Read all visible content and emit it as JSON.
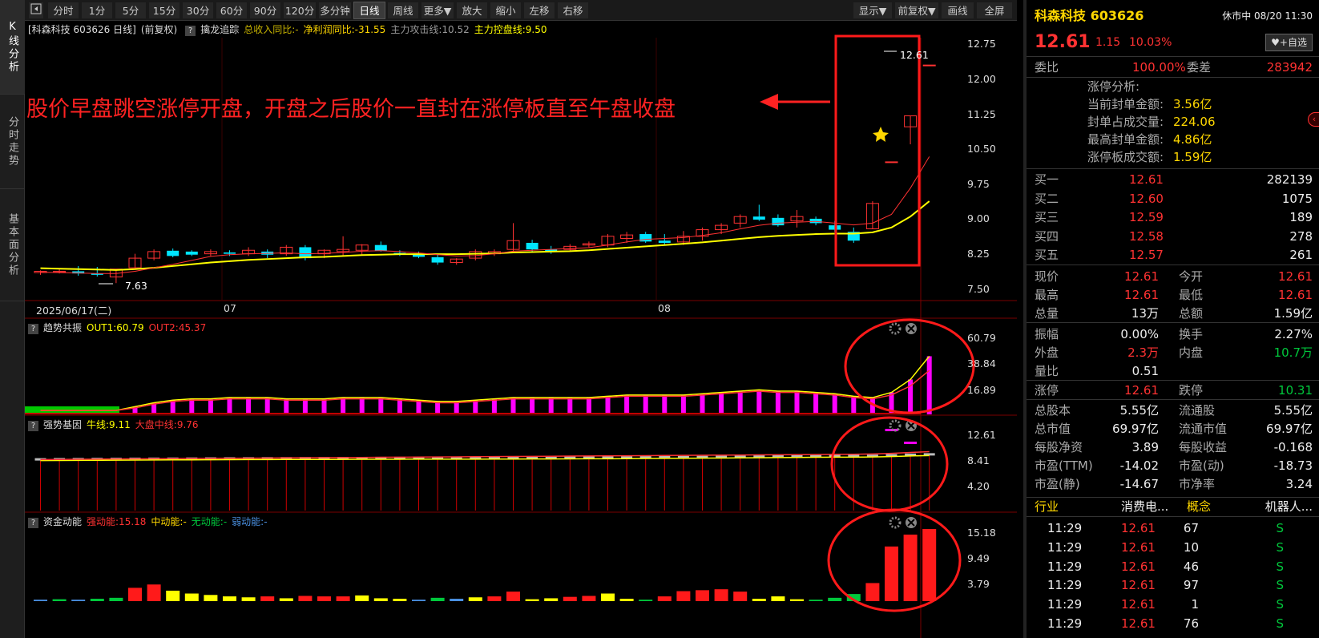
{
  "left_tabs": [
    "K线分析",
    "分时走势",
    "基本面分析"
  ],
  "toolbar": {
    "collapse_icon": "left-bracket-arrow-icon",
    "periods": [
      "分时",
      "1分",
      "5分",
      "15分",
      "30分",
      "60分",
      "90分",
      "120分",
      "多分钟",
      "日线",
      "周线",
      "更多▼"
    ],
    "active_period": "日线",
    "actions": [
      "放大",
      "缩小",
      "左移",
      "右移"
    ],
    "right_actions": [
      "显示▼",
      "前复权▼",
      "画线",
      "全屏"
    ]
  },
  "colors": {
    "up": "#ff3232",
    "down": "#00e5ff",
    "ma_yellow": "#ffff00",
    "magenta": "#ff00ff",
    "green": "#00c83c",
    "annotation": "#ff2222"
  },
  "main_chart": {
    "header": {
      "title": "[科森科技 603626 日线]",
      "adjust": "(前复权)",
      "q": "?",
      "indicator": "擒龙追踪",
      "revenue": "总收入同比:-",
      "profit": "净利润同比:-31.55",
      "attack": "主力攻击线:10.52",
      "control": "主力控盘线:9.50"
    },
    "annotation": "股价早盘跳空涨停开盘，开盘之后股价一直封在涨停板直至午盘收盘",
    "high_label": "12.61",
    "low_label": "7.63",
    "date_labels": [
      "2025/06/17(二)",
      "07",
      "08"
    ],
    "y_ticks": [
      "12.75",
      "12.00",
      "11.25",
      "10.50",
      "9.75",
      "9.00",
      "8.25",
      "7.50"
    ]
  },
  "panel1": {
    "q": "?",
    "name": "趋势共振",
    "out1": "OUT1:60.79",
    "out2": "OUT2:45.37",
    "y_ticks": [
      "60.79",
      "38.84",
      "16.89"
    ]
  },
  "panel2": {
    "q": "?",
    "name": "强势基因",
    "bull": "牛线:9.11",
    "market": "大盘中线:9.76",
    "y_ticks": [
      "12.61",
      "8.41",
      "4.20"
    ]
  },
  "panel3": {
    "q": "?",
    "name": "资金动能",
    "strong": "强动能:15.18",
    "mid": "中动能:-",
    "none": "无动能:-",
    "weak": "弱动能:-",
    "y_ticks": [
      "15.18",
      "9.49",
      "3.79"
    ]
  },
  "chart_data": {
    "type": "candlestick",
    "candles": [
      [
        7.87,
        7.92,
        7.82,
        7.9
      ],
      [
        7.88,
        7.95,
        7.85,
        7.9
      ],
      [
        7.9,
        8.02,
        7.8,
        7.85
      ],
      [
        7.85,
        8.0,
        7.78,
        7.82
      ],
      [
        7.77,
        7.95,
        7.63,
        7.95
      ],
      [
        7.98,
        8.3,
        7.95,
        8.2
      ],
      [
        8.2,
        8.4,
        8.15,
        8.35
      ],
      [
        8.37,
        8.42,
        8.22,
        8.25
      ],
      [
        8.35,
        8.38,
        8.25,
        8.28
      ],
      [
        8.3,
        8.4,
        8.25,
        8.35
      ],
      [
        8.33,
        8.38,
        8.25,
        8.3
      ],
      [
        8.3,
        8.45,
        8.25,
        8.38
      ],
      [
        8.35,
        8.4,
        8.2,
        8.28
      ],
      [
        8.3,
        8.5,
        8.25,
        8.45
      ],
      [
        8.45,
        8.5,
        8.15,
        8.2
      ],
      [
        8.3,
        8.4,
        8.2,
        8.38
      ],
      [
        8.35,
        8.7,
        8.25,
        8.4
      ],
      [
        8.38,
        8.52,
        8.28,
        8.5
      ],
      [
        8.5,
        8.58,
        8.35,
        8.37
      ],
      [
        8.32,
        8.38,
        8.25,
        8.28
      ],
      [
        8.3,
        8.35,
        8.2,
        8.23
      ],
      [
        8.22,
        8.3,
        8.05,
        8.1
      ],
      [
        8.1,
        8.2,
        8.05,
        8.18
      ],
      [
        8.2,
        8.4,
        8.15,
        8.35
      ],
      [
        8.3,
        8.4,
        8.25,
        8.35
      ],
      [
        8.4,
        9.0,
        8.35,
        8.6
      ],
      [
        8.55,
        8.62,
        8.35,
        8.4
      ],
      [
        8.4,
        8.48,
        8.3,
        8.35
      ],
      [
        8.4,
        8.52,
        8.35,
        8.47
      ],
      [
        8.5,
        8.58,
        8.45,
        8.53
      ],
      [
        8.5,
        8.75,
        8.45,
        8.7
      ],
      [
        8.65,
        8.8,
        8.55,
        8.73
      ],
      [
        8.75,
        8.8,
        8.55,
        8.58
      ],
      [
        8.6,
        8.75,
        8.5,
        8.55
      ],
      [
        8.57,
        8.82,
        8.5,
        8.7
      ],
      [
        8.7,
        8.9,
        8.6,
        8.85
      ],
      [
        8.85,
        9.0,
        8.75,
        8.95
      ],
      [
        9.0,
        9.2,
        8.9,
        9.15
      ],
      [
        9.15,
        9.42,
        9.05,
        9.08
      ],
      [
        9.12,
        9.2,
        8.92,
        8.95
      ],
      [
        9.05,
        9.3,
        8.9,
        9.15
      ],
      [
        9.1,
        9.15,
        8.95,
        9.0
      ],
      [
        8.95,
        9.05,
        8.8,
        8.85
      ],
      [
        8.8,
        8.9,
        8.55,
        8.6
      ],
      [
        8.87,
        9.5,
        8.87,
        9.45
      ],
      [
        10.4,
        10.4,
        10.4,
        10.4
      ],
      [
        11.2,
        11.45,
        10.8,
        11.45
      ],
      [
        12.61,
        12.61,
        12.61,
        12.61
      ]
    ],
    "ma_yellow": [
      7.97,
      7.96,
      7.95,
      7.94,
      7.93,
      7.95,
      7.98,
      8.02,
      8.06,
      8.1,
      8.13,
      8.16,
      8.18,
      8.2,
      8.22,
      8.23,
      8.25,
      8.27,
      8.28,
      8.29,
      8.29,
      8.29,
      8.29,
      8.3,
      8.31,
      8.33,
      8.34,
      8.35,
      8.36,
      8.38,
      8.41,
      8.44,
      8.47,
      8.5,
      8.53,
      8.56,
      8.6,
      8.64,
      8.68,
      8.71,
      8.73,
      8.75,
      8.76,
      8.76,
      8.79,
      8.9,
      9.15,
      9.5
    ],
    "ma_red": [
      7.88,
      7.87,
      7.86,
      7.85,
      7.85,
      7.9,
      7.98,
      8.06,
      8.15,
      8.24,
      8.28,
      8.3,
      8.31,
      8.32,
      8.3,
      8.31,
      8.33,
      8.36,
      8.37,
      8.35,
      8.32,
      8.28,
      8.25,
      8.26,
      8.3,
      8.36,
      8.38,
      8.4,
      8.42,
      8.44,
      8.5,
      8.57,
      8.63,
      8.65,
      8.67,
      8.72,
      8.78,
      8.87,
      8.95,
      9.0,
      9.02,
      9.04,
      9.0,
      8.96,
      9.0,
      9.2,
      9.8,
      10.52
    ],
    "trend_out1": [
      3,
      3,
      3,
      3,
      3,
      6,
      9,
      11,
      12,
      12,
      13,
      13,
      13,
      12,
      12,
      12,
      13,
      13,
      13,
      12,
      11,
      10,
      10,
      11,
      12,
      13,
      13,
      13,
      13,
      13,
      14,
      15,
      15,
      15,
      15,
      16,
      17,
      18,
      19,
      18,
      18,
      17,
      16,
      14,
      13,
      17,
      27,
      45,
      60.79
    ],
    "trend_out2": [
      3,
      3,
      3,
      3,
      3,
      5,
      8,
      10,
      11,
      11,
      12,
      12,
      12,
      11,
      11,
      11,
      12,
      12,
      12,
      11,
      10,
      9,
      9,
      10,
      11,
      12,
      12,
      12,
      12,
      12,
      13,
      14,
      14,
      14,
      14,
      15,
      16,
      17,
      18,
      17,
      17,
      16,
      15,
      13,
      12,
      15,
      22,
      34,
      45.37
    ],
    "gene_bull": [
      8.28,
      8.3,
      8.31,
      8.33,
      8.35,
      8.37,
      8.38,
      8.39,
      8.4,
      8.42,
      8.43,
      8.44,
      8.45,
      8.46,
      8.47,
      8.47,
      8.48,
      8.49,
      8.5,
      8.5,
      8.51,
      8.51,
      8.52,
      8.52,
      8.53,
      8.53,
      8.54,
      8.55,
      8.56,
      8.57,
      8.58,
      8.6,
      8.62,
      8.64,
      8.66,
      8.68,
      8.7,
      8.72,
      8.75,
      8.78,
      8.8,
      8.82,
      8.84,
      8.85,
      8.87,
      8.95,
      9.05,
      9.11
    ],
    "gene_market": [
      8.45,
      8.47,
      8.5,
      8.52,
      8.54,
      8.56,
      8.58,
      8.6,
      8.62,
      8.64,
      8.66,
      8.68,
      8.7,
      8.72,
      8.74,
      8.76,
      8.78,
      8.8,
      8.82,
      8.84,
      8.86,
      8.88,
      8.9,
      8.92,
      8.94,
      8.96,
      8.98,
      9.0,
      9.02,
      9.04,
      9.06,
      9.08,
      9.1,
      9.12,
      9.14,
      9.16,
      9.18,
      9.2,
      9.22,
      9.24,
      9.26,
      9.28,
      9.3,
      9.33,
      9.38,
      9.48,
      9.62,
      9.76
    ],
    "fund_bars": [
      [
        0.3,
        "blue"
      ],
      [
        0.4,
        "green"
      ],
      [
        0.3,
        "blue"
      ],
      [
        0.5,
        "green"
      ],
      [
        0.7,
        "green"
      ],
      [
        2.8,
        "red"
      ],
      [
        3.5,
        "red"
      ],
      [
        2.2,
        "yellow"
      ],
      [
        1.6,
        "yellow"
      ],
      [
        1.3,
        "yellow"
      ],
      [
        1.0,
        "yellow"
      ],
      [
        0.8,
        "yellow"
      ],
      [
        1.0,
        "red"
      ],
      [
        0.6,
        "yellow"
      ],
      [
        1.1,
        "red"
      ],
      [
        1.0,
        "red"
      ],
      [
        1.0,
        "red"
      ],
      [
        1.2,
        "yellow"
      ],
      [
        0.6,
        "yellow"
      ],
      [
        0.5,
        "yellow"
      ],
      [
        0.3,
        "blue"
      ],
      [
        0.7,
        "green"
      ],
      [
        0.5,
        "blue"
      ],
      [
        0.8,
        "yellow"
      ],
      [
        1.0,
        "red"
      ],
      [
        2.0,
        "red"
      ],
      [
        0.4,
        "yellow"
      ],
      [
        0.6,
        "yellow"
      ],
      [
        0.9,
        "red"
      ],
      [
        1.1,
        "red"
      ],
      [
        1.6,
        "yellow"
      ],
      [
        0.5,
        "yellow"
      ],
      [
        0.3,
        "green"
      ],
      [
        1.0,
        "red"
      ],
      [
        2.1,
        "red"
      ],
      [
        2.3,
        "red"
      ],
      [
        2.5,
        "red"
      ],
      [
        2.0,
        "red"
      ],
      [
        0.5,
        "yellow"
      ],
      [
        1.0,
        "yellow"
      ],
      [
        0.4,
        "yellow"
      ],
      [
        0.3,
        "green"
      ],
      [
        0.7,
        "green"
      ],
      [
        1.5,
        "green"
      ],
      [
        3.8,
        "red"
      ],
      [
        11.5,
        "red"
      ],
      [
        14.0,
        "red"
      ],
      [
        15.18,
        "red"
      ]
    ]
  },
  "right_panel": {
    "name": "科森科技 603626",
    "status": "休市中 08/20 11:30",
    "price": "12.61",
    "change": "1.15",
    "change_pct": "10.03%",
    "watch_btn": "♥+自选",
    "weibi_label": "委比",
    "weibi": "100.00%",
    "weicha_label": "委差",
    "weicha": "283942",
    "limit_title": "涨停分析:",
    "limit_rows": [
      {
        "label": "当前封单金额:",
        "value": "3.56亿"
      },
      {
        "label": "封单占成交量:",
        "value": "224.06"
      },
      {
        "label": "最高封单金额:",
        "value": "4.86亿"
      },
      {
        "label": "涨停板成交额:",
        "value": "1.59亿"
      }
    ],
    "buy_rows": [
      {
        "label": "买一",
        "price": "12.61",
        "vol": "282139"
      },
      {
        "label": "买二",
        "price": "12.60",
        "vol": "1075"
      },
      {
        "label": "买三",
        "price": "12.59",
        "vol": "189"
      },
      {
        "label": "买四",
        "price": "12.58",
        "vol": "278"
      },
      {
        "label": "买五",
        "price": "12.57",
        "vol": "261"
      }
    ],
    "stats1": [
      [
        "现价",
        "12.61",
        "今开",
        "12.61"
      ],
      [
        "最高",
        "12.61",
        "最低",
        "12.61"
      ],
      [
        "总量",
        "13万",
        "总额",
        "1.59亿"
      ]
    ],
    "stats2": [
      [
        "振幅",
        "0.00%",
        "换手",
        "2.27%"
      ],
      [
        "外盘",
        "2.3万",
        "内盘",
        "10.7万"
      ],
      [
        "量比",
        "0.51",
        "",
        ""
      ]
    ],
    "stats3": [
      [
        "涨停",
        "12.61",
        "跌停",
        "10.31"
      ]
    ],
    "stats4": [
      [
        "总股本",
        "5.55亿",
        "流通股",
        "5.55亿"
      ],
      [
        "总市值",
        "69.97亿",
        "流通市值",
        "69.97亿"
      ],
      [
        "每股净资",
        "3.89",
        "每股收益",
        "-0.168"
      ],
      [
        "市盈(TTM)",
        "-14.02",
        "市盈(动)",
        "-18.73"
      ],
      [
        "市盈(静)",
        "-14.67",
        "市净率",
        "3.24"
      ]
    ],
    "industry": {
      "label": "行业",
      "value": "消费电...",
      "concept_label": "概念",
      "concept": "机器人..."
    },
    "ticks": [
      [
        "11:29",
        "12.61",
        "67",
        "S"
      ],
      [
        "11:29",
        "12.61",
        "10",
        "S"
      ],
      [
        "11:29",
        "12.61",
        "46",
        "S"
      ],
      [
        "11:29",
        "12.61",
        "97",
        "S"
      ],
      [
        "11:29",
        "12.61",
        "1",
        "S"
      ],
      [
        "11:29",
        "12.61",
        "76",
        "S"
      ]
    ],
    "side_arrow_icon": "chevron-left-icon"
  }
}
